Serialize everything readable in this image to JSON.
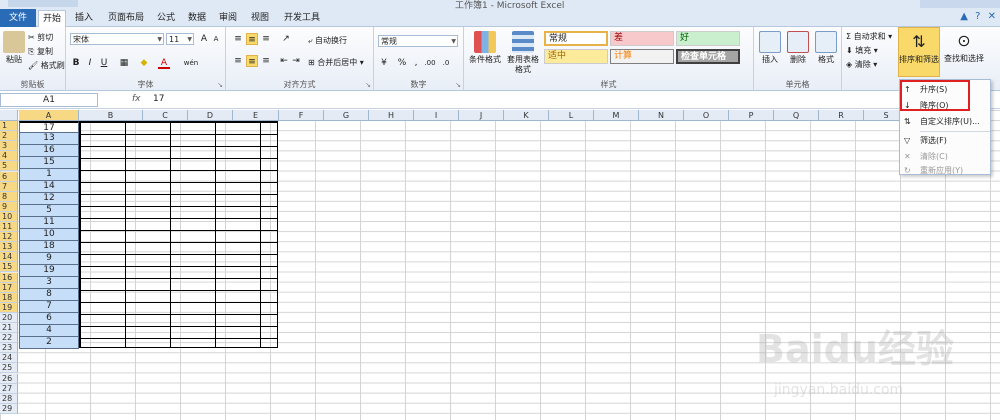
{
  "window": {
    "title": "工作簿1 - Microsoft Excel"
  },
  "tabs": [
    "文件",
    "开始",
    "插入",
    "页面布局",
    "公式",
    "数据",
    "审阅",
    "视图",
    "开发工具"
  ],
  "ribbon": {
    "clipboard": {
      "label": "剪贴板",
      "paste": "粘贴",
      "cut": "剪切",
      "copy": "复制",
      "format_painter": "格式刷"
    },
    "font": {
      "label": "字体",
      "name": "宋体",
      "size": "11",
      "bold": "B",
      "italic": "I",
      "underline": "U",
      "grow": "A",
      "shrink": "A",
      "wen": "wén"
    },
    "alignment": {
      "label": "对齐方式",
      "wrap": "自动换行",
      "merge": "合并后居中"
    },
    "number": {
      "label": "数字",
      "format": "常规",
      "percent": "%",
      "comma": ",",
      "inc": ".00",
      "dec": ".0"
    },
    "styles": {
      "label": "样式",
      "cond_format": "条件格式",
      "table_format": "套用表格格式",
      "normal": "常规",
      "bad": "差",
      "good": "好",
      "neutral": "适中",
      "calc": "计算",
      "check": "检查单元格"
    },
    "cells": {
      "label": "单元格",
      "insert": "插入",
      "delete": "删除",
      "format": "格式"
    },
    "editing": {
      "autosum": "自动求和",
      "fill": "填充",
      "clear": "清除",
      "sort_filter": "排序和筛选",
      "find_select": "查找和选择"
    }
  },
  "formula_bar": {
    "name_box": "A1",
    "fx": "fx",
    "value": "17"
  },
  "grid": {
    "columns": [
      "A",
      "B",
      "C",
      "D",
      "E",
      "F",
      "G",
      "H",
      "I",
      "J",
      "K",
      "L",
      "M",
      "N",
      "O",
      "P",
      "Q",
      "R",
      "S"
    ],
    "rows": [
      "1",
      "2",
      "3",
      "4",
      "5",
      "6",
      "7",
      "8",
      "9",
      "10",
      "11",
      "12",
      "13",
      "14",
      "15",
      "16",
      "17",
      "18",
      "19",
      "20",
      "21",
      "22",
      "23",
      "24",
      "25",
      "26",
      "27",
      "28",
      "29"
    ],
    "columnA": [
      "17",
      "13",
      "16",
      "15",
      "1",
      "14",
      "12",
      "5",
      "11",
      "10",
      "18",
      "9",
      "19",
      "3",
      "8",
      "7",
      "6",
      "4",
      "2"
    ]
  },
  "sort_menu": {
    "items": [
      {
        "label": "升序(S)",
        "icon": "sort-ascending-icon"
      },
      {
        "label": "降序(O)",
        "icon": "sort-descending-icon"
      },
      {
        "label": "自定义排序(U)...",
        "icon": "custom-sort-icon"
      },
      {
        "label": "筛选(F)",
        "icon": "filter-icon"
      },
      {
        "label": "清除(C)",
        "icon": "clear-filter-icon"
      },
      {
        "label": "重新应用(Y)",
        "icon": "reapply-icon"
      }
    ]
  },
  "watermark": {
    "brand": "Bai",
    "logo_text": "du",
    "cn": "经验",
    "url": "jingyan.baidu.com"
  },
  "colors": {
    "accent": "#2a6bb7",
    "selection": "#c6def7",
    "header_selected": "#f7d985",
    "highlight_box": "#e02020"
  }
}
